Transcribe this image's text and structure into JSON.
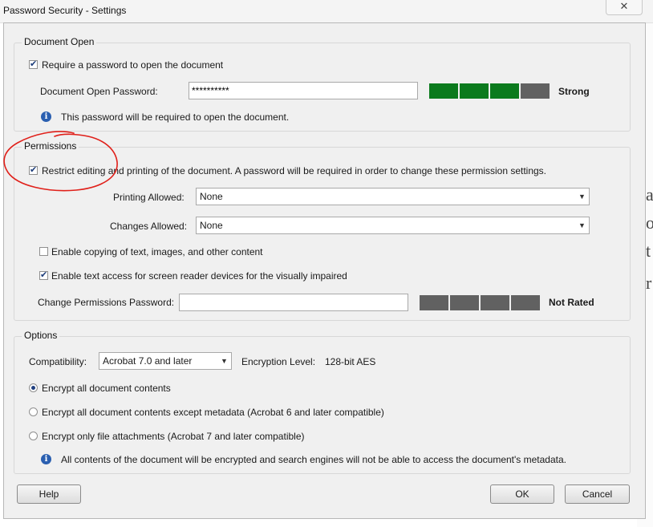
{
  "window": {
    "title": "Password Security - Settings",
    "close_glyph": "✕"
  },
  "document_open": {
    "group_label": "Document Open",
    "require_password_label": "Require a password to open the document",
    "require_password_checked": true,
    "password_label": "Document Open Password:",
    "password_value": "**********",
    "strength_label": "Strong",
    "strength_level": 3,
    "strength_segments": 4,
    "info_text": "This password will be required to open the document."
  },
  "permissions": {
    "group_label": "Permissions",
    "restrict_label": "Restrict editing and printing of the document. A password will be required in order to change these permission settings.",
    "restrict_checked": true,
    "printing_label": "Printing Allowed:",
    "printing_value": "None",
    "changes_label": "Changes Allowed:",
    "changes_value": "None",
    "copy_label": "Enable copying of text, images, and other content",
    "copy_checked": false,
    "reader_label": "Enable text access for screen reader devices for the visually impaired",
    "reader_checked": true,
    "password_label": "Change Permissions Password:",
    "password_value": "",
    "strength_label": "Not Rated",
    "strength_level": 0,
    "strength_segments": 4
  },
  "options": {
    "group_label": "Options",
    "compat_label": "Compatibility:",
    "compat_value": "Acrobat 7.0 and later",
    "encryption_label": "Encryption  Level:",
    "encryption_value": "128-bit AES",
    "radio_all": "Encrypt all document contents",
    "radio_except_metadata": "Encrypt all document contents except metadata (Acrobat 6 and later compatible)",
    "radio_attachments": "Encrypt only file attachments (Acrobat 7 and later compatible)",
    "selected": "all",
    "info_text": "All contents of the document will be encrypted and search engines will not be able to access the document's metadata."
  },
  "buttons": {
    "help": "Help",
    "ok": "OK",
    "cancel": "Cancel"
  },
  "icons": {
    "info": "info-icon",
    "dropdown": "chevron-down-icon",
    "close": "close-icon"
  },
  "colors": {
    "strength_on": "#0b7a1d",
    "strength_off": "#616161",
    "annotation": "#e0201a"
  }
}
